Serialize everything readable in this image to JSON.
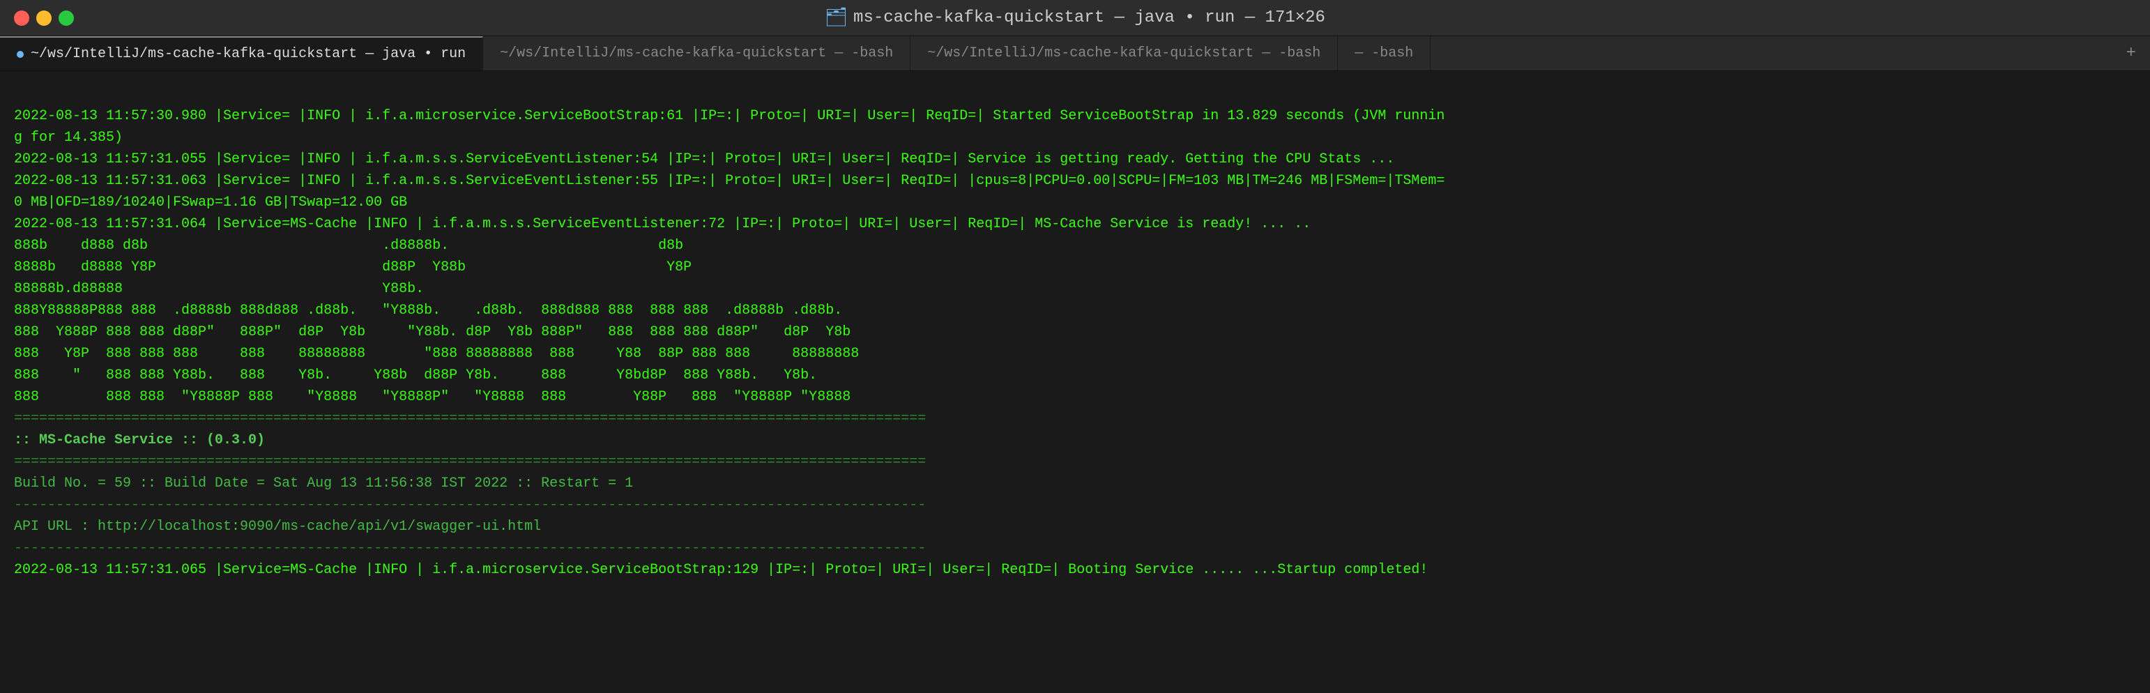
{
  "titlebar": {
    "title": "ms-cache-kafka-quickstart — java • run — 171×26",
    "folder_icon": "🗂"
  },
  "tabs": [
    {
      "id": "tab1",
      "label": "~/ws/IntelliJ/ms-cache-kafka-quickstart — java • run",
      "active": true,
      "has_dot": true
    },
    {
      "id": "tab2",
      "label": "~/ws/IntelliJ/ms-cache-kafka-quickstart — -bash",
      "active": false,
      "has_dot": false
    },
    {
      "id": "tab3",
      "label": "~/ws/IntelliJ/ms-cache-kafka-quickstart — -bash",
      "active": false,
      "has_dot": false
    },
    {
      "id": "tab4",
      "label": "— -bash",
      "active": false,
      "has_dot": false
    }
  ],
  "terminal_lines": [
    "2022-08-13 11:57:30.980 |Service= |INFO | i.f.a.microservice.ServiceBootStrap:61 |IP=:| Proto=| URI=| User=| ReqID=| Started ServiceBootStrap in 13.829 seconds (JVM runnin",
    "g for 14.385)",
    "2022-08-13 11:57:31.055 |Service= |INFO | i.f.a.m.s.s.ServiceEventListener:54 |IP=:| Proto=| URI=| User=| ReqID=| Service is getting ready. Getting the CPU Stats ...",
    "2022-08-13 11:57:31.063 |Service= |INFO | i.f.a.m.s.s.ServiceEventListener:55 |IP=:| Proto=| URI=| User=| ReqID=| |cpus=8|PCPU=0.00|SCPU=|FM=103 MB|TM=246 MB|FSMem=|TSMem=",
    "0 MB|OFD=189/10240|FSwap=1.16 GB|TSwap=12.00 GB",
    "2022-08-13 11:57:31.064 |Service=MS-Cache |INFO | i.f.a.m.s.s.ServiceEventListener:72 |IP=:| Proto=| URI=| User=| ReqID=| MS-Cache Service is ready! ... ..",
    "",
    "888b    d888 d8b                            .d8888b.                         d8b",
    "8888b   d8888 Y8P                           d88P  Y88b                        Y8P",
    "88888b.d88888                               Y88b.",
    "888Y88888P888 888  .d8888b 888d888 .d88b.   \"Y888b.    .d88b.  888d888 888  888 888  .d8888b .d88b.",
    "888  Y888P 888 888 d88P\"   888P\"  d8P  Y8b     \"Y88b. d8P  Y8b 888P\"   888  888 888 d88P\"   d8P  Y8b",
    "888   Y8P  888 888 888     888    88888888       \"888 88888888  888     Y88  88P 888 888     88888888",
    "888    \"   888 888 Y88b.   888    Y8b.     Y88b  d88P Y8b.     888      Y8bd8P  888 Y88b.   Y8b.",
    "888        888 888  \"Y8888P 888    \"Y8888   \"Y8888P\"   \"Y8888  888        Y88P   888  \"Y8888P \"Y8888",
    "",
    "=============================================================================================================",
    ":: MS-Cache Service :: (0.3.0)",
    "=============================================================================================================",
    "Build No. = 59 :: Build Date = Sat Aug 13 11:56:38 IST 2022 :: Restart = 1",
    "-------------------------------------------------------------------------------------------------------------",
    "API URL : http://localhost:9090/ms-cache/api/v1/swagger-ui.html",
    "-------------------------------------------------------------------------------------------------------------",
    "2022-08-13 11:57:31.065 |Service=MS-Cache |INFO | i.f.a.microservice.ServiceBootStrap:129 |IP=:| Proto=| URI=| User=| ReqID=| Booting Service ..... ...Startup completed!"
  ]
}
